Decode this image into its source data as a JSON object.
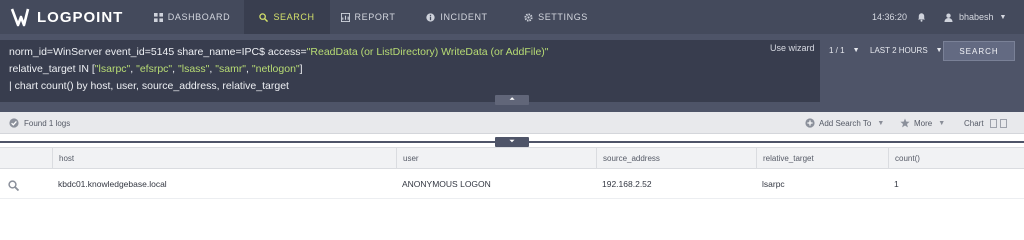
{
  "app": {
    "logo_text": "LOGPOINT"
  },
  "nav": {
    "items": [
      {
        "label": "DASHBOARD",
        "icon": "dashboard-icon"
      },
      {
        "label": "SEARCH",
        "icon": "search-icon",
        "active": true
      },
      {
        "label": "REPORT",
        "icon": "report-icon"
      },
      {
        "label": "INCIDENT",
        "icon": "info-icon"
      },
      {
        "label": "SETTINGS",
        "icon": "gear-icon"
      }
    ],
    "time": "14:36:20",
    "username": "bhabesh"
  },
  "query": {
    "line1_plain": "norm_id=WinServer event_id=5145 share_name=IPC$ access=",
    "line1_string": "\"ReadData (or ListDirectory) WriteData (or AddFile)\"",
    "line2_prefix": "relative_target IN [",
    "line2_items": [
      "\"lsarpc\"",
      "\"efsrpc\"",
      "\"lsass\"",
      "\"samr\"",
      "\"netlogon\""
    ],
    "line2_sep": ", ",
    "line2_suffix": "]",
    "line3": "| chart count() by host, user, source_address, relative_target",
    "wizard_label": "Use wizard",
    "pager": "1 / 1",
    "time_range": "LAST 2 HOURS",
    "search_button": "SEARCH"
  },
  "status": {
    "found_text": "Found 1 logs",
    "add_search_to": "Add Search To",
    "more": "More",
    "chart": "Chart"
  },
  "table": {
    "columns": [
      "host",
      "user",
      "source_address",
      "relative_target",
      "count()"
    ],
    "rows": [
      {
        "host": "kbdc01.knowledgebase.local",
        "user": "ANONYMOUS LOGON",
        "source_address": "192.168.2.52",
        "relative_target": "lsarpc",
        "count": "1"
      }
    ]
  },
  "colors": {
    "nav_bg": "#444a5c",
    "accent": "#d4e16b",
    "query_string": "#b8dc74",
    "query_bg": "#383d4e"
  }
}
